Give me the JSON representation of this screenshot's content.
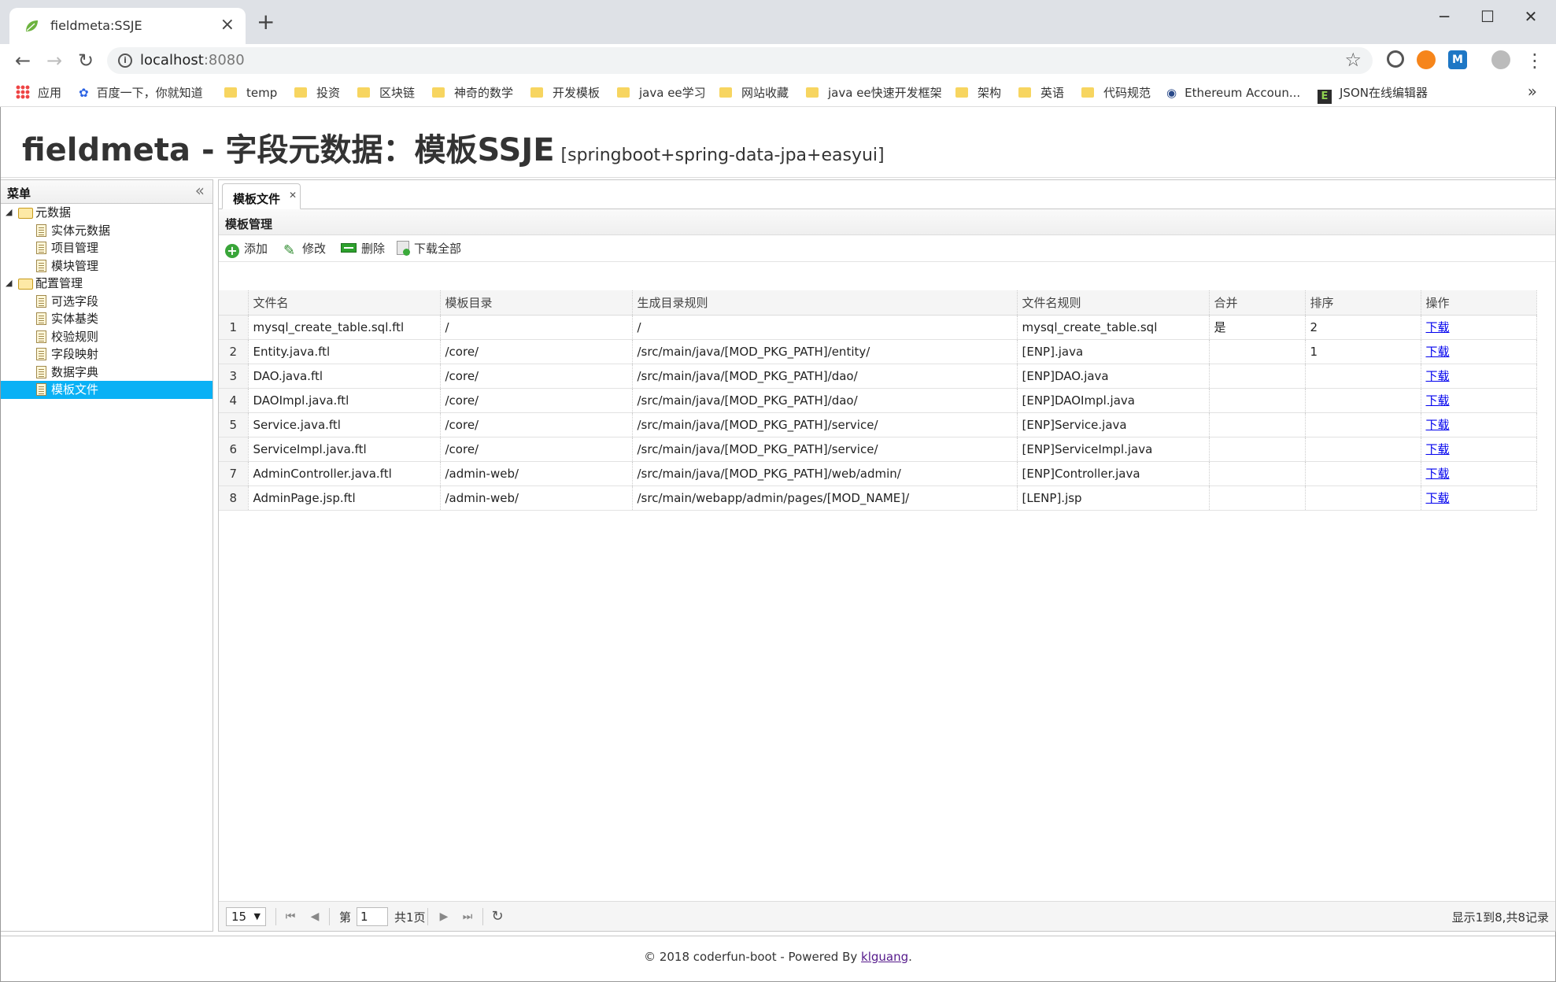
{
  "browser": {
    "tab_title": "fieldmeta:SSJE",
    "new_tab": "+",
    "url_host": "localhost",
    "url_port": ":8080",
    "bookmarks": [
      "应用",
      "百度一下，你就知道",
      "temp",
      "投资",
      "区块链",
      "神奇的数学",
      "开发模板",
      "java ee学习",
      "网站收藏",
      "java ee快速开发框架",
      "架构",
      "英语",
      "代码规范",
      "Ethereum Accoun...",
      "JSON在线编辑器"
    ],
    "bookmarks_more": "»",
    "ext_m": "M"
  },
  "app": {
    "title": "fieldmeta - 字段元数据：模板SSJE",
    "subtitle": "[springboot+spring-data-jpa+easyui]"
  },
  "menu": {
    "title": "菜单",
    "groups": [
      {
        "label": "元数据",
        "items": [
          "实体元数据",
          "项目管理",
          "模块管理"
        ]
      },
      {
        "label": "配置管理",
        "items": [
          "可选字段",
          "实体基类",
          "校验规则",
          "字段映射",
          "数据字典",
          "模板文件"
        ]
      }
    ],
    "selected": "模板文件"
  },
  "tabs": {
    "active": "模板文件"
  },
  "grid": {
    "title": "模板管理",
    "toolbar": {
      "add": "添加",
      "edit": "修改",
      "delete": "删除",
      "download_all": "下载全部"
    },
    "columns": [
      "文件名",
      "模板目录",
      "生成目录规则",
      "文件名规则",
      "合并",
      "排序",
      "操作"
    ],
    "rows": [
      {
        "n": "1",
        "file": "mysql_create_table.sql.ftl",
        "dir": "/",
        "rule": "/",
        "name_rule": "mysql_create_table.sql",
        "merge": "是",
        "order": "2",
        "action": "下载"
      },
      {
        "n": "2",
        "file": "Entity.java.ftl",
        "dir": "/core/",
        "rule": "/src/main/java/[MOD_PKG_PATH]/entity/",
        "name_rule": "[ENP].java",
        "merge": "",
        "order": "1",
        "action": "下载"
      },
      {
        "n": "3",
        "file": "DAO.java.ftl",
        "dir": "/core/",
        "rule": "/src/main/java/[MOD_PKG_PATH]/dao/",
        "name_rule": "[ENP]DAO.java",
        "merge": "",
        "order": "",
        "action": "下载"
      },
      {
        "n": "4",
        "file": "DAOImpl.java.ftl",
        "dir": "/core/",
        "rule": "/src/main/java/[MOD_PKG_PATH]/dao/",
        "name_rule": "[ENP]DAOImpl.java",
        "merge": "",
        "order": "",
        "action": "下载"
      },
      {
        "n": "5",
        "file": "Service.java.ftl",
        "dir": "/core/",
        "rule": "/src/main/java/[MOD_PKG_PATH]/service/",
        "name_rule": "[ENP]Service.java",
        "merge": "",
        "order": "",
        "action": "下载"
      },
      {
        "n": "6",
        "file": "ServiceImpl.java.ftl",
        "dir": "/core/",
        "rule": "/src/main/java/[MOD_PKG_PATH]/service/",
        "name_rule": "[ENP]ServiceImpl.java",
        "merge": "",
        "order": "",
        "action": "下载"
      },
      {
        "n": "7",
        "file": "AdminController.java.ftl",
        "dir": "/admin-web/",
        "rule": "/src/main/java/[MOD_PKG_PATH]/web/admin/",
        "name_rule": "[ENP]Controller.java",
        "merge": "",
        "order": "",
        "action": "下载"
      },
      {
        "n": "8",
        "file": "AdminPage.jsp.ftl",
        "dir": "/admin-web/",
        "rule": "/src/main/webapp/admin/pages/[MOD_NAME]/",
        "name_rule": "[LENP].jsp",
        "merge": "",
        "order": "",
        "action": "下载"
      }
    ]
  },
  "pager": {
    "page_size": "15",
    "page_prefix": "第",
    "page": "1",
    "page_total": "共1页",
    "info": "显示1到8,共8记录"
  },
  "footer": {
    "text": "© 2018 coderfun-boot - Powered By ",
    "link": "klguang",
    "end": "."
  }
}
